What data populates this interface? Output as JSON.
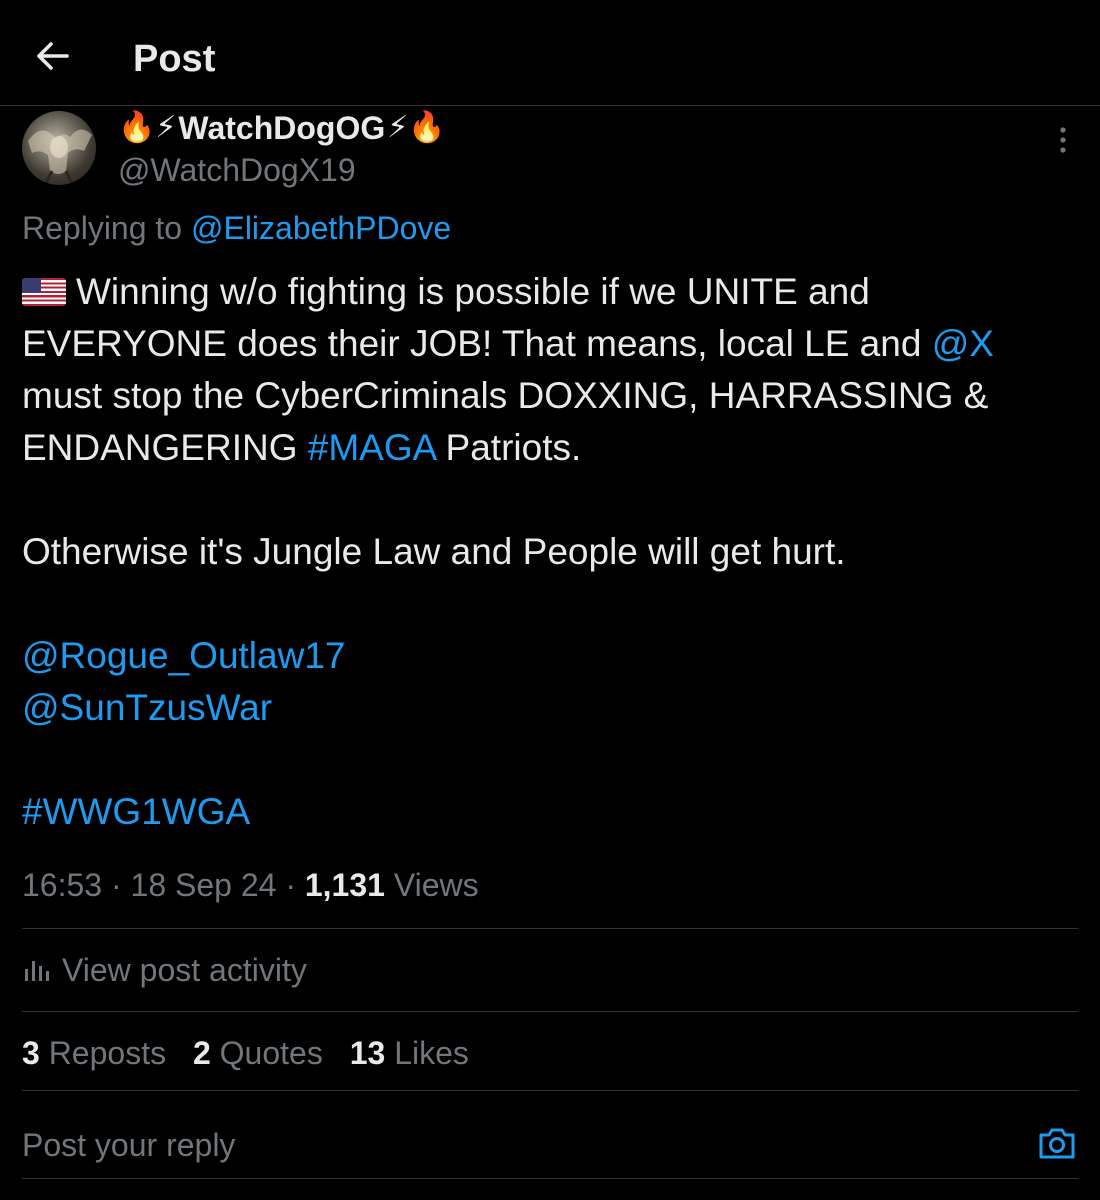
{
  "header": {
    "title": "Post",
    "back_icon": "arrow-left-icon"
  },
  "author": {
    "display_name": "WatchDogOG",
    "name_prefix_emoji": "🔥⚡",
    "name_suffix_emoji": "⚡🔥",
    "handle": "@WatchDogX19"
  },
  "reply_context": {
    "prefix": "Replying to",
    "to_handle": "@ElizabethPDove"
  },
  "post": {
    "line1_text": "Winning w/o fighting is possible if we UNITE and",
    "line2_text": "EVERYONE does their JOB! That means, local LE and",
    "line2_mention": "@X",
    "line3_text": "must stop the CyberCriminals DOXXING, HARRASSING &",
    "line4_text": "ENDANGERING",
    "line4_hashtag": "#MAGA",
    "line4_suffix": "Patriots.",
    "line5_text": "Otherwise it's Jungle Law and People will get hurt.",
    "mention1": "@Rogue_Outlaw17",
    "mention2": "@SunTzusWar",
    "hashtag": "#WWG1WGA"
  },
  "meta": {
    "time": "16:53",
    "date": "18 Sep 24",
    "views_count": "1,131",
    "views_label": "Views"
  },
  "activity": {
    "label": "View post activity"
  },
  "stats": {
    "reposts_count": "3",
    "reposts_label": "Reposts",
    "quotes_count": "2",
    "quotes_label": "Quotes",
    "likes_count": "13",
    "likes_label": "Likes"
  },
  "reply": {
    "placeholder": "Post your reply"
  },
  "colors": {
    "background": "#000000",
    "text": "#e7e9ea",
    "secondary": "#71767b",
    "accent": "#1d9bf0",
    "divider": "#2f3336"
  }
}
